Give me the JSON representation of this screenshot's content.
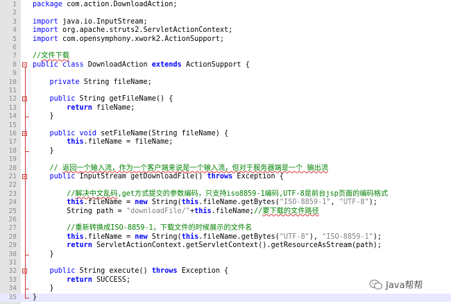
{
  "editor": {
    "lines": [
      {
        "n": "1",
        "tokens": [
          {
            "t": "package",
            "c": "kwn"
          },
          {
            "t": " com.action.DownloadAction;",
            "c": "tx"
          }
        ]
      },
      {
        "n": "2",
        "tokens": []
      },
      {
        "n": "3",
        "tokens": [
          {
            "t": "import",
            "c": "kwn"
          },
          {
            "t": " java.io.InputStream;",
            "c": "tx"
          }
        ]
      },
      {
        "n": "4",
        "tokens": [
          {
            "t": "import",
            "c": "kwn"
          },
          {
            "t": " org.apache.struts2.ServletActionContext;",
            "c": "tx"
          }
        ]
      },
      {
        "n": "5",
        "tokens": [
          {
            "t": "import",
            "c": "kwn"
          },
          {
            "t": " com.opensymphony.xwork2.ActionSupport;",
            "c": "tx"
          }
        ]
      },
      {
        "n": "6",
        "tokens": []
      },
      {
        "n": "7",
        "tokens": [
          {
            "t": "//",
            "c": "cm"
          },
          {
            "t": "文件下载",
            "c": "cm sq"
          }
        ]
      },
      {
        "n": "8",
        "fold": "start",
        "tokens": [
          {
            "t": "public class",
            "c": "kwn"
          },
          {
            "t": " DownloadAction ",
            "c": "tx"
          },
          {
            "t": "extends",
            "c": "kw"
          },
          {
            "t": " ActionSupport {",
            "c": "tx"
          }
        ]
      },
      {
        "n": "9",
        "tokens": []
      },
      {
        "n": "10",
        "tokens": [
          {
            "t": "    private",
            "c": "kwn"
          },
          {
            "t": " String fileName;",
            "c": "tx"
          }
        ]
      },
      {
        "n": "11",
        "tokens": []
      },
      {
        "n": "12",
        "fold": "start",
        "tokens": [
          {
            "t": "    public",
            "c": "kwn"
          },
          {
            "t": " String getFileName() {",
            "c": "tx"
          }
        ]
      },
      {
        "n": "13",
        "tokens": [
          {
            "t": "        return",
            "c": "kw"
          },
          {
            "t": " fileName;",
            "c": "tx"
          }
        ]
      },
      {
        "n": "14",
        "fold": "end",
        "tokens": [
          {
            "t": "    }",
            "c": "tx"
          }
        ]
      },
      {
        "n": "15",
        "tokens": []
      },
      {
        "n": "16",
        "fold": "start",
        "tokens": [
          {
            "t": "    public void",
            "c": "kwn"
          },
          {
            "t": " setFileName(String fileName) {",
            "c": "tx"
          }
        ]
      },
      {
        "n": "17",
        "tokens": [
          {
            "t": "        this",
            "c": "kw"
          },
          {
            "t": ".fileName = fileName;",
            "c": "tx"
          }
        ]
      },
      {
        "n": "18",
        "fold": "end",
        "tokens": [
          {
            "t": "    }",
            "c": "tx"
          }
        ]
      },
      {
        "n": "19",
        "tokens": []
      },
      {
        "n": "20",
        "tokens": [
          {
            "t": "    // ",
            "c": "cm"
          },
          {
            "t": "返回一个输入流，作为一个客户端来说是一个输入流，但对于服务器端是一个 输出流",
            "c": "cm sq"
          }
        ]
      },
      {
        "n": "21",
        "fold": "start",
        "tokens": [
          {
            "t": "    public",
            "c": "kwn"
          },
          {
            "t": " InputStream getDownloadFile() ",
            "c": "tx"
          },
          {
            "t": "throws",
            "c": "kw"
          },
          {
            "t": " Exception {",
            "c": "tx"
          }
        ]
      },
      {
        "n": "22",
        "tokens": []
      },
      {
        "n": "23",
        "tokens": [
          {
            "t": "        //",
            "c": "cm"
          },
          {
            "t": "解决中文乱码",
            "c": "cm sq"
          },
          {
            "t": ",get方式提交的参数编码，只支持iso8859-1编码,UTF-8是前台jsp页面的编码格式",
            "c": "cm"
          }
        ]
      },
      {
        "n": "24",
        "tokens": [
          {
            "t": "        this",
            "c": "kw"
          },
          {
            "t": ".fileName = ",
            "c": "tx"
          },
          {
            "t": "new",
            "c": "kw"
          },
          {
            "t": " String(",
            "c": "tx"
          },
          {
            "t": "this",
            "c": "kw"
          },
          {
            "t": ".fileName.getBytes(",
            "c": "tx"
          },
          {
            "t": "\"ISO-8859-1\"",
            "c": "str"
          },
          {
            "t": ", ",
            "c": "tx"
          },
          {
            "t": "\"UTF-8\"",
            "c": "str"
          },
          {
            "t": ");",
            "c": "tx"
          }
        ]
      },
      {
        "n": "25",
        "tokens": [
          {
            "t": "        String path = ",
            "c": "tx"
          },
          {
            "t": "\"downloadFile/\"",
            "c": "str"
          },
          {
            "t": "+",
            "c": "tx"
          },
          {
            "t": "this",
            "c": "kw"
          },
          {
            "t": ".fileName;",
            "c": "tx"
          },
          {
            "t": "//",
            "c": "cm"
          },
          {
            "t": "要下载的文件路径",
            "c": "cm sq"
          }
        ]
      },
      {
        "n": "26",
        "tokens": []
      },
      {
        "n": "27",
        "tokens": [
          {
            "t": "        //重新转换成ISO-8859-1，下载文件的时候展示的文件名",
            "c": "cm"
          }
        ]
      },
      {
        "n": "28",
        "tokens": [
          {
            "t": "        this",
            "c": "kw"
          },
          {
            "t": ".fileName = ",
            "c": "tx"
          },
          {
            "t": "new",
            "c": "kw"
          },
          {
            "t": " String(",
            "c": "tx"
          },
          {
            "t": "this",
            "c": "kw"
          },
          {
            "t": ".fileName.getBytes(",
            "c": "tx"
          },
          {
            "t": "\"UTF-8\"",
            "c": "str"
          },
          {
            "t": "), ",
            "c": "tx"
          },
          {
            "t": "\"ISO-8859-1\"",
            "c": "str"
          },
          {
            "t": ");",
            "c": "tx"
          }
        ]
      },
      {
        "n": "29",
        "tokens": [
          {
            "t": "        return",
            "c": "kw"
          },
          {
            "t": " ServletActionContext.getServletContext().getResourceAsStream(path);",
            "c": "tx"
          }
        ]
      },
      {
        "n": "30",
        "fold": "end",
        "tokens": [
          {
            "t": "    }",
            "c": "tx"
          }
        ]
      },
      {
        "n": "31",
        "tokens": []
      },
      {
        "n": "32",
        "fold": "start",
        "tokens": [
          {
            "t": "    public",
            "c": "kwn"
          },
          {
            "t": " String execute() ",
            "c": "tx"
          },
          {
            "t": "throws",
            "c": "kw"
          },
          {
            "t": " Exception {",
            "c": "tx"
          }
        ]
      },
      {
        "n": "33",
        "tokens": [
          {
            "t": "        return",
            "c": "kw"
          },
          {
            "t": " SUCCESS;",
            "c": "tx"
          }
        ]
      },
      {
        "n": "34",
        "fold": "end",
        "tokens": [
          {
            "t": "    }",
            "c": "tx"
          }
        ]
      },
      {
        "n": "35",
        "fold": "end",
        "active": true,
        "tokens": [
          {
            "t": "}",
            "c": "tx"
          }
        ]
      }
    ]
  },
  "watermark": {
    "icon": "wechat-icon",
    "text": "Java帮帮"
  },
  "colors": {
    "keyword": "#0000ff",
    "string": "#808080",
    "comment": "#008000",
    "gutter": "#e4e4e4",
    "fold": "#cc3333",
    "active_line": "#e8e8ff"
  }
}
